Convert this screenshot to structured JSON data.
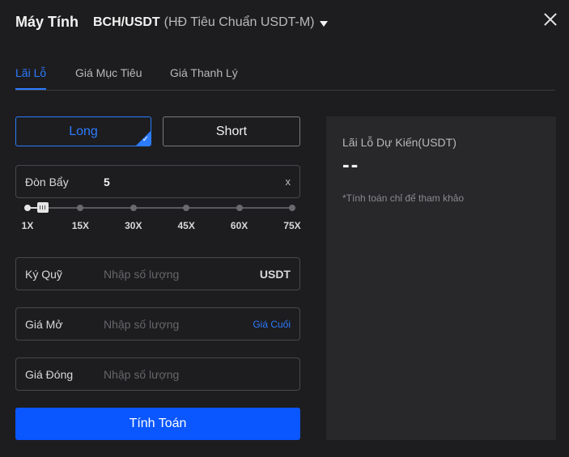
{
  "header": {
    "title": "Máy Tính",
    "pair": "BCH/USDT",
    "pair_sub": "(HĐ Tiêu Chuẩn USDT-M)"
  },
  "tabs": [
    {
      "label": "Lãi Lỗ",
      "active": true
    },
    {
      "label": "Giá Mục Tiêu",
      "active": false
    },
    {
      "label": "Giá Thanh Lý",
      "active": false
    }
  ],
  "side": {
    "long_label": "Long",
    "short_label": "Short",
    "selected": "Long",
    "check_icon": "checkmark-icon"
  },
  "leverage": {
    "label": "Đòn Bẩy",
    "value": "5",
    "clear": "x",
    "min": 1,
    "max": 75,
    "ticks": [
      "1X",
      "15X",
      "30X",
      "45X",
      "60X",
      "75X"
    ]
  },
  "margin": {
    "label": "Ký Quỹ",
    "placeholder": "Nhập số lượng",
    "suffix": "USDT"
  },
  "entry_price": {
    "label": "Giá Mở",
    "placeholder": "Nhập số lượng",
    "link": "Giá Cuối"
  },
  "exit_price": {
    "label": "Giá Đóng",
    "placeholder": "Nhập số lượng"
  },
  "calculate_label": "Tính Toán",
  "result": {
    "title": "Lãi Lỗ Dự Kiến(USDT)",
    "value": "--",
    "note": "*Tính toán chỉ để tham khảo"
  },
  "colors": {
    "accent": "#2d7bff",
    "button": "#0a56ff",
    "background": "#1d1d1f",
    "panel": "#28282b"
  }
}
